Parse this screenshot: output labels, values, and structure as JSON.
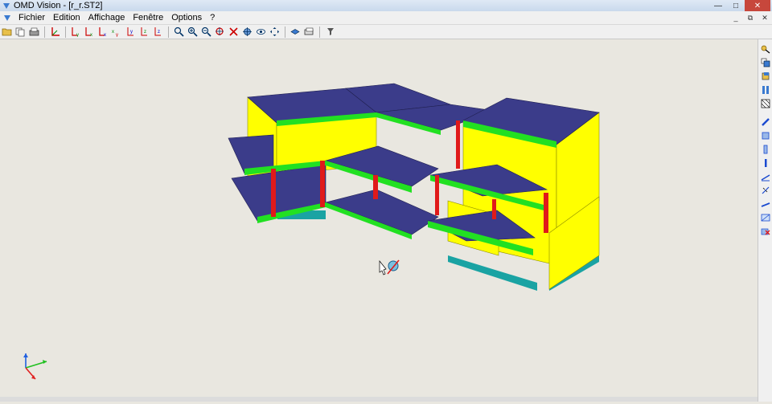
{
  "window": {
    "title": "OMD Vision - [r_r.ST2]"
  },
  "menu": {
    "items": [
      "Fichier",
      "Edition",
      "Affichage",
      "Fenêtre",
      "Options",
      "?"
    ]
  },
  "toolbar": {
    "buttons": [
      "open-icon",
      "copy-icon",
      "print-icon",
      "axis-icon",
      "view-ly-icon",
      "view-lx-icon",
      "view-lx2-icon",
      "view-xy-icon",
      "view-xy2-icon",
      "view-xz-icon",
      "view-yz-icon",
      "zoom-window-icon",
      "zoom-in-icon",
      "zoom-out-icon",
      "zoom-all-icon",
      "select-icon",
      "rotate-icon",
      "eye-icon",
      "pan-icon",
      "display-mode-icon",
      "layers-icon",
      "filter-icon"
    ]
  },
  "righttool": {
    "buttons": [
      "query-icon",
      "copy-layers-icon",
      "box-icon",
      "columns-icon",
      "mesh-icon",
      "beam-icon",
      "slab-icon",
      "wall-icon",
      "column-icon",
      "load-icon",
      "line-load-icon",
      "edge-icon",
      "frame-icon",
      "delete-icon"
    ]
  },
  "colors": {
    "slab_top": "#3b3c8a",
    "wall": "#ffff00",
    "beam": "#22e022",
    "column": "#e01a1a",
    "foundation": "#1aa3a3"
  }
}
